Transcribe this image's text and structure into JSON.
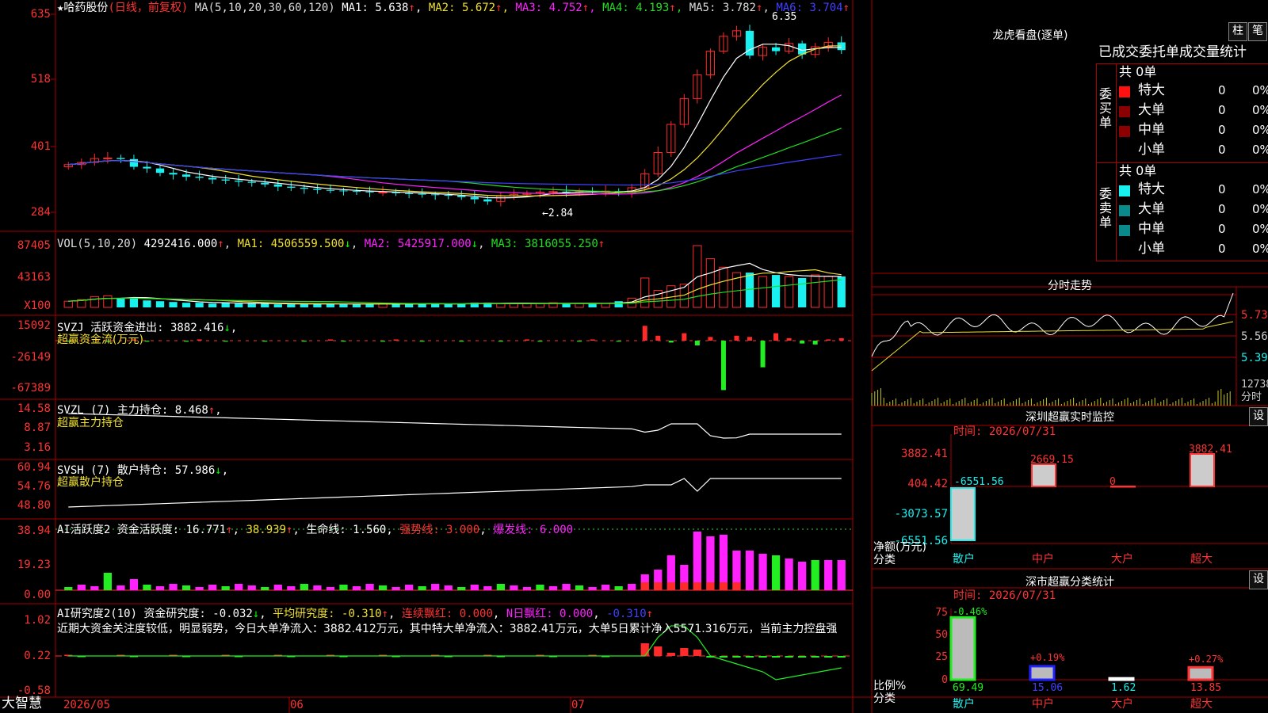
{
  "colors": {
    "up": "#ff2a2a",
    "down": "#19f0f0",
    "ma1": "#ffffff",
    "ma2": "#f0e030",
    "ma3": "#ff22ff",
    "ma4": "#22dd22",
    "ma5": "#4040ff",
    "grid": "#aa0000"
  },
  "main": {
    "title": "★哈药股份",
    "mode": "(日线，前复权)",
    "ma_label": "MA(5,10,20,30,60,120)",
    "ma": [
      {
        "n": "MA1:",
        "v": "5.638"
      },
      {
        "n": "MA2:",
        "v": "5.672"
      },
      {
        "n": "MA3:",
        "v": "4.752"
      },
      {
        "n": "MA4:",
        "v": "4.193"
      },
      {
        "n": "MA5:",
        "v": "3.782"
      },
      {
        "n": "MA6:",
        "v": "3.704"
      }
    ],
    "ticks": [
      "635",
      "518",
      "401",
      "284"
    ],
    "hi": "6.35",
    "lo": "←2.84"
  },
  "vol": {
    "label": "VOL(5,10,20)",
    "value": "4292416.000",
    "ma1": "MA1: 4506559.500",
    "ma2": "MA2: 5425917.000",
    "ma3": "MA3: 3816055.250",
    "ticks": [
      "87405",
      "43163",
      "X100"
    ]
  },
  "svzj": {
    "label": "SVZJ  活跃资金进出: 3882.416",
    "sub": "超赢资金流(万元)",
    "ticks": [
      "15092",
      "-26149",
      "-67389"
    ]
  },
  "svzl": {
    "label": "SVZL (7) 主力持仓: 8.468",
    "sub": "超赢主力持仓",
    "ticks": [
      "14.58",
      "8.87",
      "3.16"
    ]
  },
  "svsh": {
    "label": "SVSH (7) 散户持仓: 57.986",
    "sub": "超赢散户持仓",
    "ticks": [
      "60.94",
      "54.76",
      "48.80"
    ]
  },
  "ai1": {
    "label": "AI活跃度2 资金活跃度: 16.771",
    "v2": "38.939",
    "life": "生命线: 1.560",
    "strong": "强势线: 3.000",
    "burst": "爆发线: 6.000",
    "ticks": [
      "38.94",
      "19.23",
      "0.00"
    ]
  },
  "ai2": {
    "label": "AI研究度2(10) 资金研究度: -0.032",
    "avg": "平均研究度: -0.310",
    "lian": "连续飘红: 0.000",
    "nday": "N日飘红: 0.000",
    "last": "-0.310",
    "note": "近期大资金关注度较低，明显弱势，今日大单净流入：3882.412万元，其中特大单净流入：3882.41万元，大单5日累计净入5571.316万元，当前主力控盘强",
    "ticks": [
      "1.02",
      "0.22",
      "-0.58"
    ]
  },
  "xaxis": {
    "brand": "大智慧",
    "labels": [
      "2026/05",
      "06",
      "07"
    ]
  },
  "dragon": {
    "title": "龙虎看盘(逐单)",
    "btn1": "柱",
    "btn2": "笔",
    "header": "已成交委托单成交量统计",
    "buy": {
      "side": "委买单",
      "total": "共 0单",
      "rows": [
        {
          "name": "特大",
          "n": "0",
          "p": "0%"
        },
        {
          "name": "大单",
          "n": "0",
          "p": "0%"
        },
        {
          "name": "中单",
          "n": "0",
          "p": "0%"
        },
        {
          "name": "小单",
          "n": "0",
          "p": "0%"
        }
      ]
    },
    "sell": {
      "side": "委卖单",
      "total": "共 0单",
      "rows": [
        {
          "name": "特大",
          "n": "0",
          "p": "0%"
        },
        {
          "name": "大单",
          "n": "0",
          "p": "0%"
        },
        {
          "name": "中单",
          "n": "0",
          "p": "0%"
        },
        {
          "name": "小单",
          "n": "0",
          "p": "0%"
        }
      ]
    }
  },
  "intraday": {
    "title": "分时走势",
    "ticks": [
      "5.73",
      "5.56",
      "5.39"
    ],
    "vol": "12738",
    "unit": "分时"
  },
  "monitor": {
    "title": "深圳超赢实时监控",
    "btn": "设",
    "time": "时间: 2026/07/31",
    "ticks": [
      "3882.41",
      "404.42",
      "-3073.57",
      "-6551.56"
    ],
    "ylabel": "净额(万元)",
    "xlabel": "分类",
    "bars": [
      {
        "label": "散户",
        "value": "-6551.56"
      },
      {
        "label": "中户",
        "value": "2669.15"
      },
      {
        "label": "大户",
        "value": "0"
      },
      {
        "label": "超大",
        "value": "3882.41"
      }
    ]
  },
  "classify": {
    "title": "深市超赢分类统计",
    "btn": "设",
    "time": "时间: 2026/07/31",
    "ticks": [
      "75",
      "50",
      "25",
      "0"
    ],
    "ylabel": "比例%",
    "xlabel": "分类",
    "bars": [
      {
        "label": "散户",
        "value": "69.49",
        "chg": "-0.46%"
      },
      {
        "label": "中户",
        "value": "15.06",
        "chg": "+0.19%"
      },
      {
        "label": "大户",
        "value": "1.62",
        "chg": ""
      },
      {
        "label": "超大",
        "value": "13.85",
        "chg": "+0.27%"
      }
    ]
  },
  "chart_data": {
    "type": "candlestick",
    "title": "哈药股份",
    "period": "日线，前复权",
    "x": [
      "2026/05",
      "06",
      "07"
    ],
    "ylim": [
      2.84,
      6.35
    ],
    "high_label": 6.35,
    "low_label": 2.84,
    "close": [
      3.62,
      3.66,
      3.73,
      3.74,
      3.72,
      3.58,
      3.55,
      3.47,
      3.44,
      3.4,
      3.38,
      3.35,
      3.33,
      3.31,
      3.29,
      3.26,
      3.22,
      3.2,
      3.18,
      3.16,
      3.15,
      3.14,
      3.13,
      3.12,
      3.12,
      3.1,
      3.09,
      3.08,
      3.07,
      3.06,
      3.03,
      2.99,
      2.95,
      3.05,
      3.08,
      3.1,
      3.12,
      3.13,
      3.12,
      3.13,
      3.12,
      3.14,
      3.11,
      3.2,
      3.45,
      3.84,
      4.35,
      4.82,
      5.25,
      5.68,
      5.95,
      6.05,
      5.6,
      5.75,
      5.68,
      5.82,
      5.62,
      5.76,
      5.84,
      5.7
    ],
    "volume": [
      8,
      10,
      14,
      15,
      12,
      13,
      9,
      8,
      7,
      6,
      6,
      5,
      6,
      5,
      5,
      5,
      4,
      4,
      4,
      5,
      5,
      4,
      4,
      4,
      5,
      5,
      4,
      5,
      5,
      4,
      5,
      6,
      6,
      5,
      5,
      5,
      5,
      6,
      5,
      5,
      5,
      5,
      8,
      12,
      38,
      22,
      28,
      30,
      80,
      63,
      52,
      45,
      45,
      40,
      42,
      40,
      38,
      42,
      40,
      40
    ]
  }
}
